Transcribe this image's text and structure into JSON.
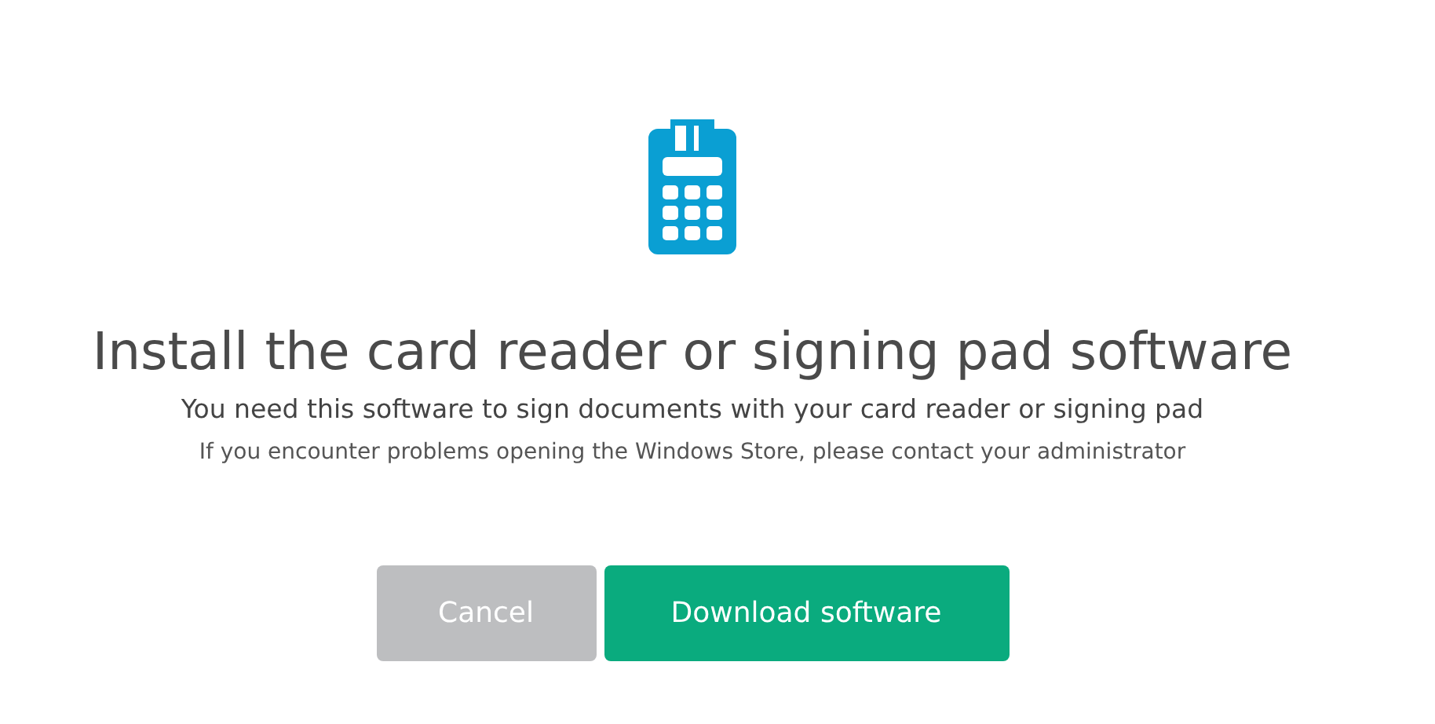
{
  "title": "Install the card reader or signing pad software",
  "subtitle": "You need this software to sign documents with your card reader or signing pad",
  "note": "If you encounter problems opening the Windows Store, please contact your administrator",
  "buttons": [
    {
      "label": "Cancel",
      "kind": "secondary"
    },
    {
      "label": "Download software",
      "kind": "primary"
    }
  ]
}
